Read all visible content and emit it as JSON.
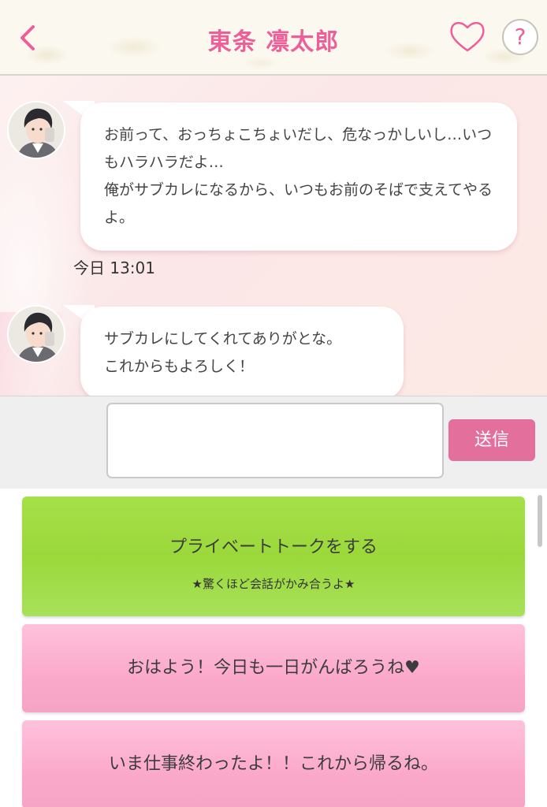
{
  "header": {
    "title": "東条 凛太郎",
    "help_label": "?"
  },
  "messages": [
    {
      "text": "お前って、おっちょこちょいだし、危なっかしいし…いつもハラハラだよ…\n俺がサブカレになるから、いつもお前のそばで支えてやるよ。",
      "time": "今日 13:01"
    },
    {
      "text": "サブカレにしてくれてありがとな。\nこれからもよろしく！"
    }
  ],
  "composer": {
    "send_label": "送信"
  },
  "options": {
    "private_talk": {
      "label": "プライベートトークをする",
      "sub": "★驚くほど会話がかみ合うよ★"
    },
    "reply_1": "おはよう！今日も一日がんばろうね♥",
    "reply_2": "いま仕事終わったよ！！これから帰るね。"
  },
  "colors": {
    "accent": "#ee5f9a",
    "send_button": "#e3709c",
    "option_green": "#9bd83a",
    "option_pink": "#fba9cb"
  },
  "icons": [
    "back-chevron-icon",
    "heart-outline-icon",
    "help-icon"
  ]
}
